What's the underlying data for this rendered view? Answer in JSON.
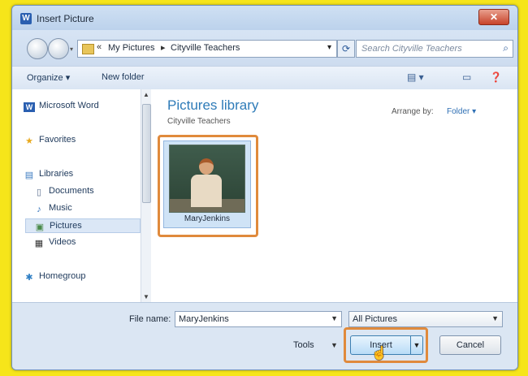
{
  "window": {
    "title": "Insert Picture",
    "app_icon": "W",
    "close_glyph": "✕"
  },
  "address": {
    "crumbs": [
      "My Pictures",
      "Cityville Teachers"
    ],
    "separator": "«",
    "arrow": "▸",
    "search_placeholder": "Search Cityville Teachers"
  },
  "toolbar": {
    "organize": "Organize ▾",
    "new_folder": "New folder"
  },
  "sidebar": {
    "items": [
      {
        "label": "Microsoft Word",
        "icon": "word-icon"
      },
      {
        "label": "Favorites",
        "icon": "star-icon"
      },
      {
        "label": "Libraries",
        "icon": "libraries-icon"
      },
      {
        "label": "Documents",
        "icon": "document-icon"
      },
      {
        "label": "Music",
        "icon": "music-icon"
      },
      {
        "label": "Pictures",
        "icon": "pictures-icon"
      },
      {
        "label": "Videos",
        "icon": "video-icon"
      },
      {
        "label": "Homegroup",
        "icon": "homegroup-icon"
      }
    ]
  },
  "main": {
    "library_title": "Pictures library",
    "library_subtitle": "Cityville Teachers",
    "arrange_label": "Arrange by:",
    "arrange_value": "Folder ▾",
    "files": [
      {
        "name": "MaryJenkins"
      }
    ]
  },
  "footer": {
    "file_name_label": "File name:",
    "file_name_value": "MaryJenkins",
    "file_type": "All Pictures",
    "tools_label": "Tools",
    "insert_label": "Insert",
    "cancel_label": "Cancel"
  },
  "colors": {
    "highlight": "#e08a3c",
    "background": "#f6e51a",
    "title_blue": "#2e7bb8"
  }
}
